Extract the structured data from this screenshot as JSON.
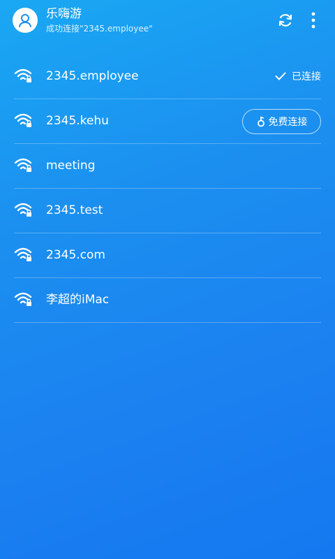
{
  "header": {
    "app_name": "乐嗨游",
    "subtitle": "成功连接\"2345.employee\""
  },
  "networks": [
    {
      "ssid": "2345.employee",
      "status": "已连接"
    },
    {
      "ssid": "2345.kehu",
      "action": "免费连接"
    },
    {
      "ssid": "meeting"
    },
    {
      "ssid": "2345.test"
    },
    {
      "ssid": "2345.com"
    },
    {
      "ssid": "李超的iMac"
    }
  ],
  "icons": {
    "avatar": "user-icon",
    "refresh": "refresh-icon",
    "more": "more-vertical-icon",
    "wifi": "wifi-locked-icon",
    "connected": "check-icon",
    "key": "key-icon"
  },
  "colors": {
    "background_top": "#1aa8f3",
    "background_bottom": "#1478f0",
    "avatar_accent": "#1c8ff0"
  }
}
